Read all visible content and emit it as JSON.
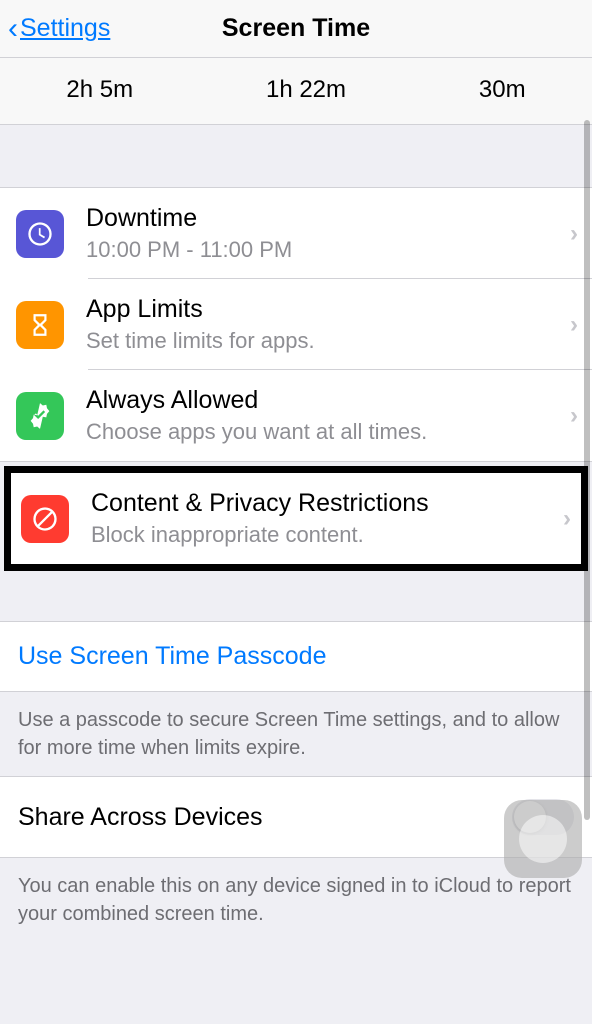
{
  "nav": {
    "back_label": "Settings",
    "title": "Screen Time"
  },
  "usage": [
    "2h 5m",
    "1h 22m",
    "30m"
  ],
  "rows": {
    "downtime": {
      "title": "Downtime",
      "subtitle": "10:00 PM - 11:00 PM"
    },
    "applimits": {
      "title": "App Limits",
      "subtitle": "Set time limits for apps."
    },
    "always": {
      "title": "Always Allowed",
      "subtitle": "Choose apps you want at all times."
    },
    "content": {
      "title": "Content & Privacy Restrictions",
      "subtitle": "Block inappropriate content."
    }
  },
  "passcode": {
    "link": "Use Screen Time Passcode",
    "footer": "Use a passcode to secure Screen Time settings, and to allow for more time when limits expire."
  },
  "share": {
    "title": "Share Across Devices",
    "footer": "You can enable this on any device signed in to iCloud to report your combined screen time."
  }
}
